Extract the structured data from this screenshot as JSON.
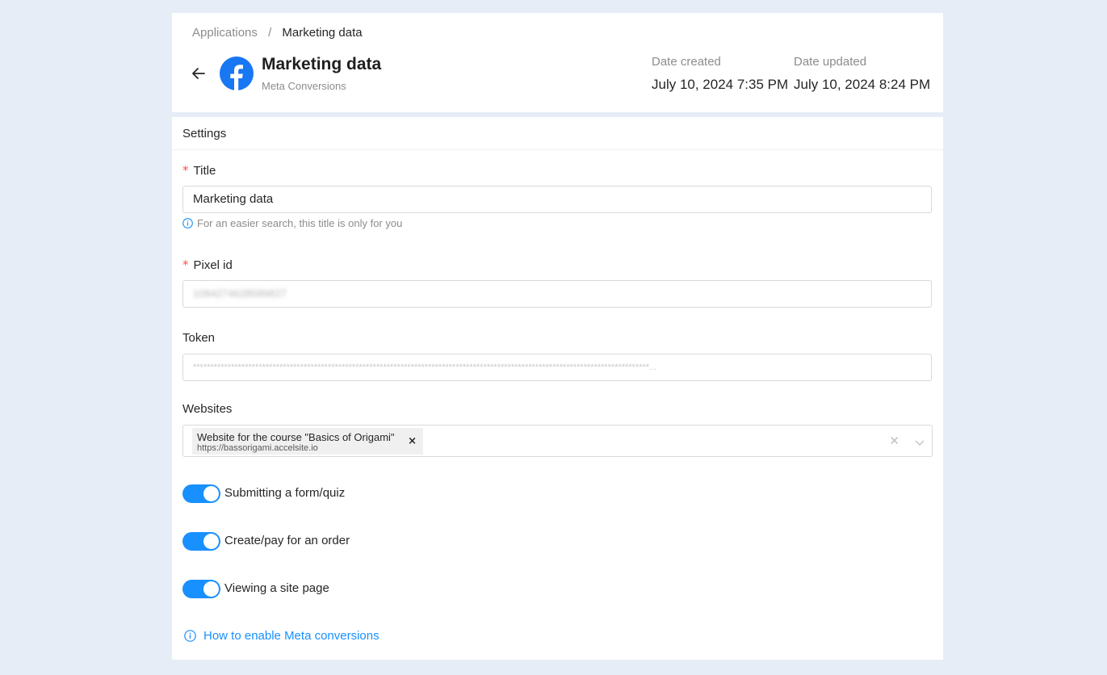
{
  "breadcrumb": {
    "parent": "Applications",
    "separator": "/",
    "current": "Marketing data"
  },
  "app": {
    "title": "Marketing data",
    "subtitle": "Meta Conversions"
  },
  "dates": {
    "created_label": "Date created",
    "created_value": "July 10, 2024 7:35 PM",
    "updated_label": "Date updated",
    "updated_value": "July 10, 2024 8:24 PM"
  },
  "settings": {
    "section_title": "Settings",
    "title_field": {
      "label": "Title",
      "value": "Marketing data",
      "hint": "For an easier search, this title is only for you"
    },
    "pixel_field": {
      "label": "Pixel id",
      "value": "1094274628589827"
    },
    "token_field": {
      "label": "Token",
      "value": "************************************************************************************************************************************..."
    },
    "websites_field": {
      "label": "Websites",
      "tag_title": "Website for the course \"Basics of Origami\"",
      "tag_url": "https://bassorigami.accelsite.io",
      "tag_remove": "×",
      "clear_symbol": "✕"
    },
    "toggles": [
      {
        "label": "Submitting a form/quiz",
        "enabled": true
      },
      {
        "label": "Create/pay for an order",
        "enabled": true
      },
      {
        "label": "Viewing a site page",
        "enabled": true
      }
    ],
    "help_link": "How to enable Meta conversions"
  },
  "colors": {
    "accent": "#1890ff",
    "facebook": "#1877f2",
    "required": "#ff4d4f",
    "page_bg": "#e6edf7"
  }
}
